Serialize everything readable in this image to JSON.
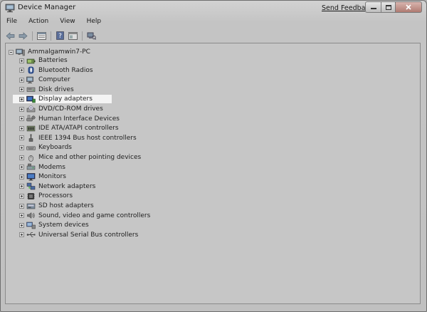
{
  "window": {
    "title": "Device Manager",
    "send_feedback": "Send Feedback"
  },
  "menu": [
    "File",
    "Action",
    "View",
    "Help"
  ],
  "toolbar_icons": [
    "back-arrow-icon",
    "forward-arrow-icon",
    "properties-grid-icon",
    "help-icon",
    "show-hidden-icon",
    "scan-hardware-icon"
  ],
  "tree": {
    "root": "Ammalgamwin7-PC",
    "items": [
      {
        "label": "Batteries",
        "icon": "battery-icon",
        "selected": false
      },
      {
        "label": "Bluetooth Radios",
        "icon": "bluetooth-icon",
        "selected": false
      },
      {
        "label": "Computer",
        "icon": "computer-icon",
        "selected": false
      },
      {
        "label": "Disk drives",
        "icon": "disk-drive-icon",
        "selected": false
      },
      {
        "label": "Display adapters",
        "icon": "display-adapter-icon",
        "selected": true
      },
      {
        "label": "DVD/CD-ROM drives",
        "icon": "dvd-drive-icon",
        "selected": false
      },
      {
        "label": "Human Interface Devices",
        "icon": "hid-icon",
        "selected": false
      },
      {
        "label": "IDE ATA/ATAPI controllers",
        "icon": "ide-controller-icon",
        "selected": false
      },
      {
        "label": "IEEE 1394 Bus host controllers",
        "icon": "ieee1394-icon",
        "selected": false
      },
      {
        "label": "Keyboards",
        "icon": "keyboard-icon",
        "selected": false
      },
      {
        "label": "Mice and other pointing devices",
        "icon": "mouse-icon",
        "selected": false
      },
      {
        "label": "Modems",
        "icon": "modem-icon",
        "selected": false
      },
      {
        "label": "Monitors",
        "icon": "monitor-icon",
        "selected": false
      },
      {
        "label": "Network adapters",
        "icon": "network-adapter-icon",
        "selected": false
      },
      {
        "label": "Processors",
        "icon": "processor-icon",
        "selected": false
      },
      {
        "label": "SD host adapters",
        "icon": "sd-host-icon",
        "selected": false
      },
      {
        "label": "Sound, video and game controllers",
        "icon": "sound-icon",
        "selected": false
      },
      {
        "label": "System devices",
        "icon": "system-devices-icon",
        "selected": false
      },
      {
        "label": "Universal Serial Bus controllers",
        "icon": "usb-icon",
        "selected": false
      }
    ]
  },
  "colors": {
    "selection": "#f4f4f4",
    "client_bg": "#c6c6c6",
    "close_button": "#b07b72"
  }
}
